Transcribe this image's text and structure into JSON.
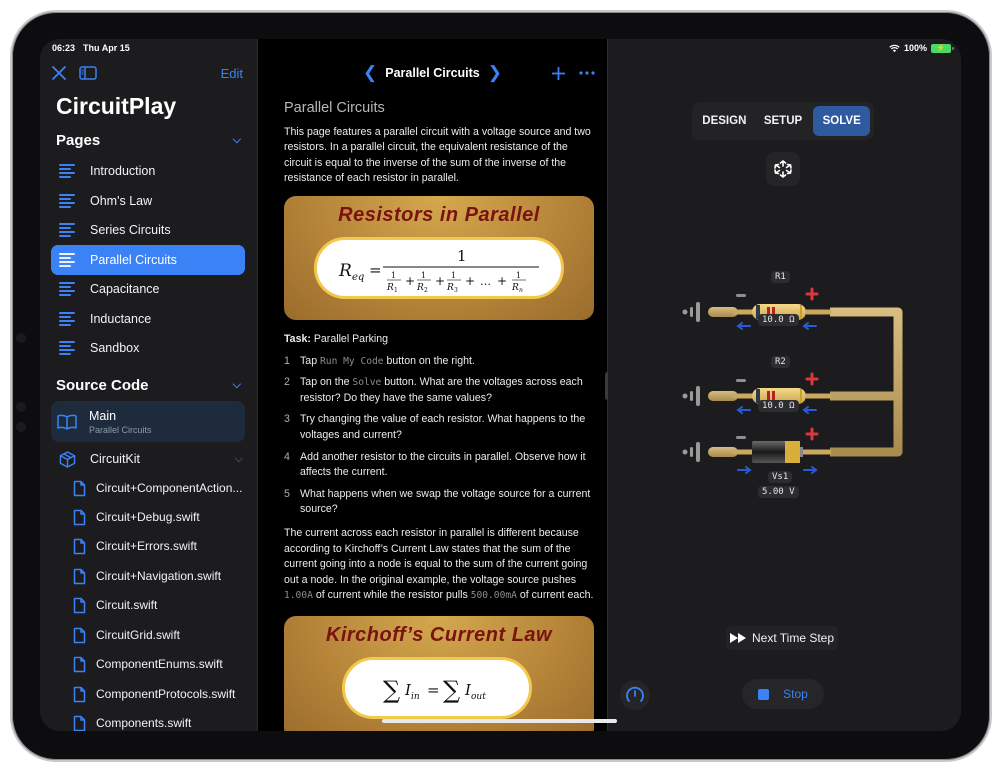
{
  "status_bar": {
    "time": "06:23",
    "date": "Thu Apr 15",
    "battery": "100%"
  },
  "sidebar": {
    "edit_label": "Edit",
    "app_title": "CircuitPlay",
    "pages_header": "Pages",
    "pages": [
      {
        "label": "Introduction",
        "active": false
      },
      {
        "label": "Ohm's Law",
        "active": false
      },
      {
        "label": "Series Circuits",
        "active": false
      },
      {
        "label": "Parallel Circuits",
        "active": true
      },
      {
        "label": "Capacitance",
        "active": false
      },
      {
        "label": "Inductance",
        "active": false
      },
      {
        "label": "Sandbox",
        "active": false
      }
    ],
    "source_header": "Source Code",
    "main_item": {
      "title": "Main",
      "subtitle": "Parallel Circuits"
    },
    "module": {
      "label": "CircuitKit"
    },
    "files": [
      "Circuit+ComponentAction...",
      "Circuit+Debug.swift",
      "Circuit+Errors.swift",
      "Circuit+Navigation.swift",
      "Circuit.swift",
      "CircuitGrid.swift",
      "ComponentEnums.swift",
      "ComponentProtocols.swift",
      "Components.swift"
    ]
  },
  "doc": {
    "nav_title": "Parallel Circuits",
    "heading": "Parallel Circuits",
    "intro": "This page features a parallel circuit with a voltage source and two resistors. In a parallel circuit, the equivalent resistance of the circuit is equal to the inverse of the sum of the inverse of the resistance of each resistor in parallel.",
    "banner1": {
      "title": "Resistors in Parallel",
      "formula_lhs": "R",
      "formula_lhs_sub": "eq",
      "numerator": "1",
      "terms": [
        "1",
        "2",
        "3",
        "n"
      ],
      "ellipsis": "…"
    },
    "task_label": "Task:",
    "task_name": "Parallel Parking",
    "steps": [
      {
        "n": "1",
        "pre": "Tap ",
        "code": "Run My Code",
        "post": " button on the right."
      },
      {
        "n": "2",
        "pre": "Tap on the ",
        "code": "Solve",
        "post": " button. What are the voltages across each resistor? Do they have the same values?"
      },
      {
        "n": "3",
        "pre": "Try changing the value of each resistor. What happens to the voltages and current?",
        "code": "",
        "post": ""
      },
      {
        "n": "4",
        "pre": "Add another resistor to the circuits in parallel. Observe how it affects the current.",
        "code": "",
        "post": ""
      },
      {
        "n": "5",
        "pre": "What happens when we swap the voltage source for a current source?",
        "code": "",
        "post": ""
      }
    ],
    "para2_a": "The current across each resistor in parallel is different because according to Kirchoff’s Current Law states that the sum of the current going into a node is equal to the sum of the current going out a node. In the original example, the voltage source pushes ",
    "para2_code1": "1.00A",
    "para2_b": " of current while the resistor pulls ",
    "para2_code2": "500.00mA",
    "para2_c": " of current each.",
    "banner2": {
      "title": "Kirchoff’s Current Law",
      "formula_in": "in",
      "formula_out": "out"
    }
  },
  "sim": {
    "modes": [
      {
        "label": "DESIGN",
        "selected": false
      },
      {
        "label": "SETUP",
        "selected": false
      },
      {
        "label": "SOLVE",
        "selected": true
      }
    ],
    "components": [
      {
        "name": "R1",
        "value": "10.0 Ω",
        "type": "resistor"
      },
      {
        "name": "R2",
        "value": "10.0 Ω",
        "type": "resistor"
      },
      {
        "name": "Vs1",
        "value": "5.00 V",
        "type": "voltage-source"
      }
    ],
    "next_step_label": "Next Time Step",
    "stop_label": "Stop"
  },
  "colors": {
    "accent": "#3b82f6",
    "selected_mode": "#2f5aa0",
    "wire": "#c8a865",
    "plus": "#d9393c",
    "current_arrow": "#2a5bd7"
  }
}
